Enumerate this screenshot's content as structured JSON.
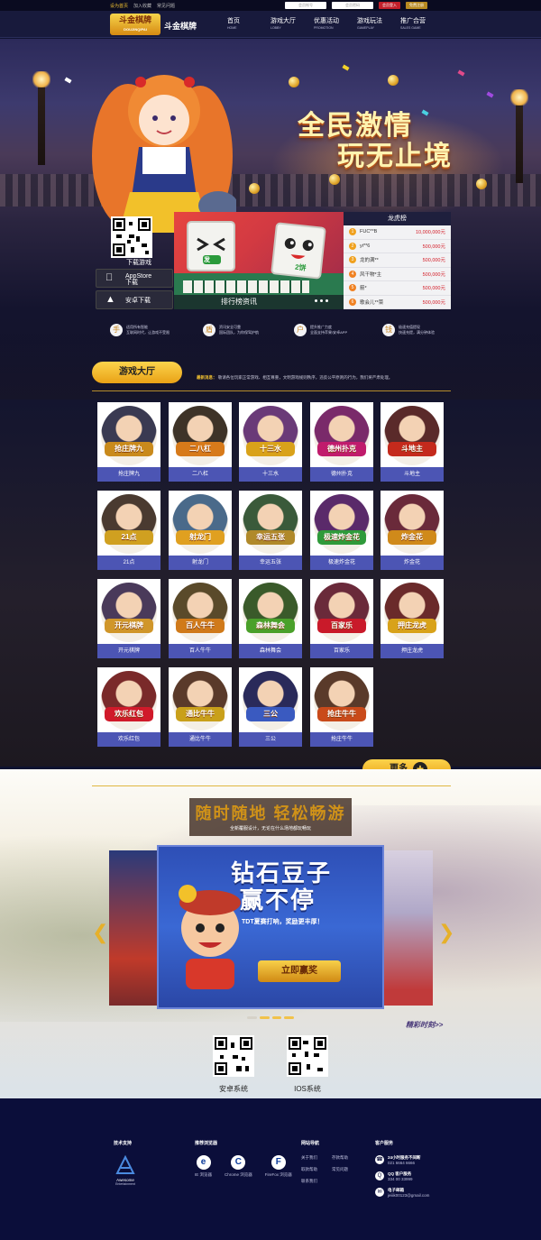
{
  "topbar": {
    "links": [
      "设为首页",
      "加入收藏",
      "常见问题"
    ],
    "account_placeholder": "会员帐号",
    "password_placeholder": "会员密码",
    "login_label": "会员登入",
    "register_label": "免费注册"
  },
  "nav": {
    "logo_text": "斗金棋牌",
    "logo_sub": "DOUJINQIPAI",
    "brand": "斗金棋牌",
    "items": [
      {
        "label": "首页",
        "sub": "HOME"
      },
      {
        "label": "游戏大厅",
        "sub": "LOBBY"
      },
      {
        "label": "优惠活动",
        "sub": "PROMOTION"
      },
      {
        "label": "游戏玩法",
        "sub": "GAMEPLAY"
      },
      {
        "label": "推广合营",
        "sub": "SALES GAME"
      }
    ]
  },
  "hero": {
    "slogan_line1": "全民激情",
    "slogan_line2": "玩无止境"
  },
  "download": {
    "label": "下载游戏",
    "appstore_line1": "AppStore",
    "appstore_line2": "下载",
    "android": "安卓下载"
  },
  "banner": {
    "caption": "排行榜资讯",
    "tile_text_1": "发",
    "tile_text_2": "2饼"
  },
  "ranking": {
    "title": "龙虎榜",
    "rows": [
      {
        "rank": "1",
        "name": "FUC**B",
        "amount": "10,000,000元"
      },
      {
        "rank": "2",
        "name": "yi**6",
        "amount": "500,000元"
      },
      {
        "rank": "3",
        "name": "龙的满**",
        "amount": "500,000元"
      },
      {
        "rank": "4",
        "name": "风干物*主",
        "amount": "500,000元"
      },
      {
        "rank": "5",
        "name": "箭*",
        "amount": "500,000元"
      },
      {
        "rank": "6",
        "name": "歌会儿**菜",
        "amount": "500,000元"
      }
    ]
  },
  "features": [
    {
      "icon": "手",
      "line1": "适用所有智能",
      "line2": "互联网时代，让游戏不受限"
    },
    {
      "icon": "盾",
      "line1": "资讯安全可靠",
      "line2": "国际团队，为你保驾护航"
    },
    {
      "icon": "户",
      "line1": "提升推广力度",
      "line2": "全面支持苹果/安卓APP"
    },
    {
      "icon": "钱",
      "line1": "极速充值提现",
      "line2": "快速充提，满分钟体验"
    }
  ],
  "hall": {
    "tab": "游戏大厅",
    "notice_label": "最新消息：",
    "notice_text": "敬请各位玩家正常游戏、相互尊重，文明游戏规则秩序，违反公平原则的行为，我们将严肃处理。",
    "more": "更多"
  },
  "games": [
    {
      "name": "抢庄牌九",
      "badge": "抢庄牌九",
      "bg": "#3a3a52",
      "badge_color": "#c98a1c"
    },
    {
      "name": "二八杠",
      "badge": "二八杠",
      "bg": "#3e3328",
      "badge_color": "#d77a1a"
    },
    {
      "name": "十三水",
      "badge": "十三水",
      "bg": "#6a3a78",
      "badge_color": "#d9a21a"
    },
    {
      "name": "德州扑克",
      "badge": "德州扑克",
      "bg": "#7a2a6a",
      "badge_color": "#c01b6c"
    },
    {
      "name": "斗地主",
      "badge": "斗地主",
      "bg": "#5a2a2a",
      "badge_color": "#c42a1c"
    },
    {
      "name": "21点",
      "badge": "21点",
      "bg": "#4a3a30",
      "badge_color": "#d0a020"
    },
    {
      "name": "射龙门",
      "badge": "射龙门",
      "bg": "#4a6a8a",
      "badge_color": "#e0a020"
    },
    {
      "name": "幸运五张",
      "badge": "幸运五张",
      "bg": "#3a5a3a",
      "badge_color": "#b0892a"
    },
    {
      "name": "极速炸金花",
      "badge": "极速炸金花",
      "bg": "#5a2a6a",
      "badge_color": "#2f9a3a"
    },
    {
      "name": "炸金花",
      "badge": "炸金花",
      "bg": "#6a2a3a",
      "badge_color": "#d08a1a"
    },
    {
      "name": "开元棋牌",
      "badge": "开元棋牌",
      "bg": "#4a3a5a",
      "badge_color": "#d0962a"
    },
    {
      "name": "百人牛牛",
      "badge": "百人牛牛",
      "bg": "#5a4a2a",
      "badge_color": "#d07a1a"
    },
    {
      "name": "森林舞会",
      "badge": "森林舞会",
      "bg": "#3a5a2a",
      "badge_color": "#4aa02a"
    },
    {
      "name": "百家乐",
      "badge": "百家乐",
      "bg": "#6a2a3a",
      "badge_color": "#c91a2a"
    },
    {
      "name": "押庄龙虎",
      "badge": "押庄龙虎",
      "bg": "#6a2a2a",
      "badge_color": "#d8a21a"
    },
    {
      "name": "欢乐红包",
      "badge": "欢乐红包",
      "bg": "#7a2a2a",
      "badge_color": "#d01a2a"
    },
    {
      "name": "通比牛牛",
      "badge": "通比牛牛",
      "bg": "#5a3a2a",
      "badge_color": "#c9a01a"
    },
    {
      "name": "三公",
      "badge": "三公",
      "bg": "#2a2a5a",
      "badge_color": "#3a5ac0"
    },
    {
      "name": "抢庄牛牛",
      "badge": "抢庄牛牛",
      "bg": "#5a3a2a",
      "badge_color": "#c94a1a"
    }
  ],
  "mobile": {
    "title": "随时随地 轻松畅游",
    "subtitle": "全新覆服设计，无论在什么场地都玩畅玩",
    "carousel_big_1": "钻石豆子",
    "carousel_big_2": "赢不停",
    "carousel_sub": "TDT夏赛打响，奖励更丰厚！",
    "carousel_cta": "立即赢奖",
    "more_link": "精彩时刻>>",
    "qr_android": "安卓系统",
    "qr_ios": "IOS系统"
  },
  "footer": {
    "tech_title": "技术支持",
    "tech_brand": "Awesome",
    "tech_brand_sub": "Entertainment",
    "browser_title": "推荐浏览器",
    "browsers": [
      {
        "icon": "e",
        "name": "IE 浏览器"
      },
      {
        "icon": "C",
        "name": "Chrome 浏览器"
      },
      {
        "icon": "F",
        "name": "FireFox 浏览器"
      }
    ],
    "nav_title": "网站导航",
    "nav_links": [
      "关于我们",
      "存款帮助",
      "取款帮助",
      "常见问题",
      "联系我们"
    ],
    "service_title": "客户服务",
    "services": [
      {
        "icon": "☎",
        "title": "24小时服务不间断",
        "value": "021 6664 6666"
      },
      {
        "icon": "Q",
        "title": "QQ 客户服务",
        "value": "334 00 33999"
      },
      {
        "icon": "✉",
        "title": "电子邮箱",
        "value": "jeiiik00123@gmail.com"
      }
    ]
  }
}
